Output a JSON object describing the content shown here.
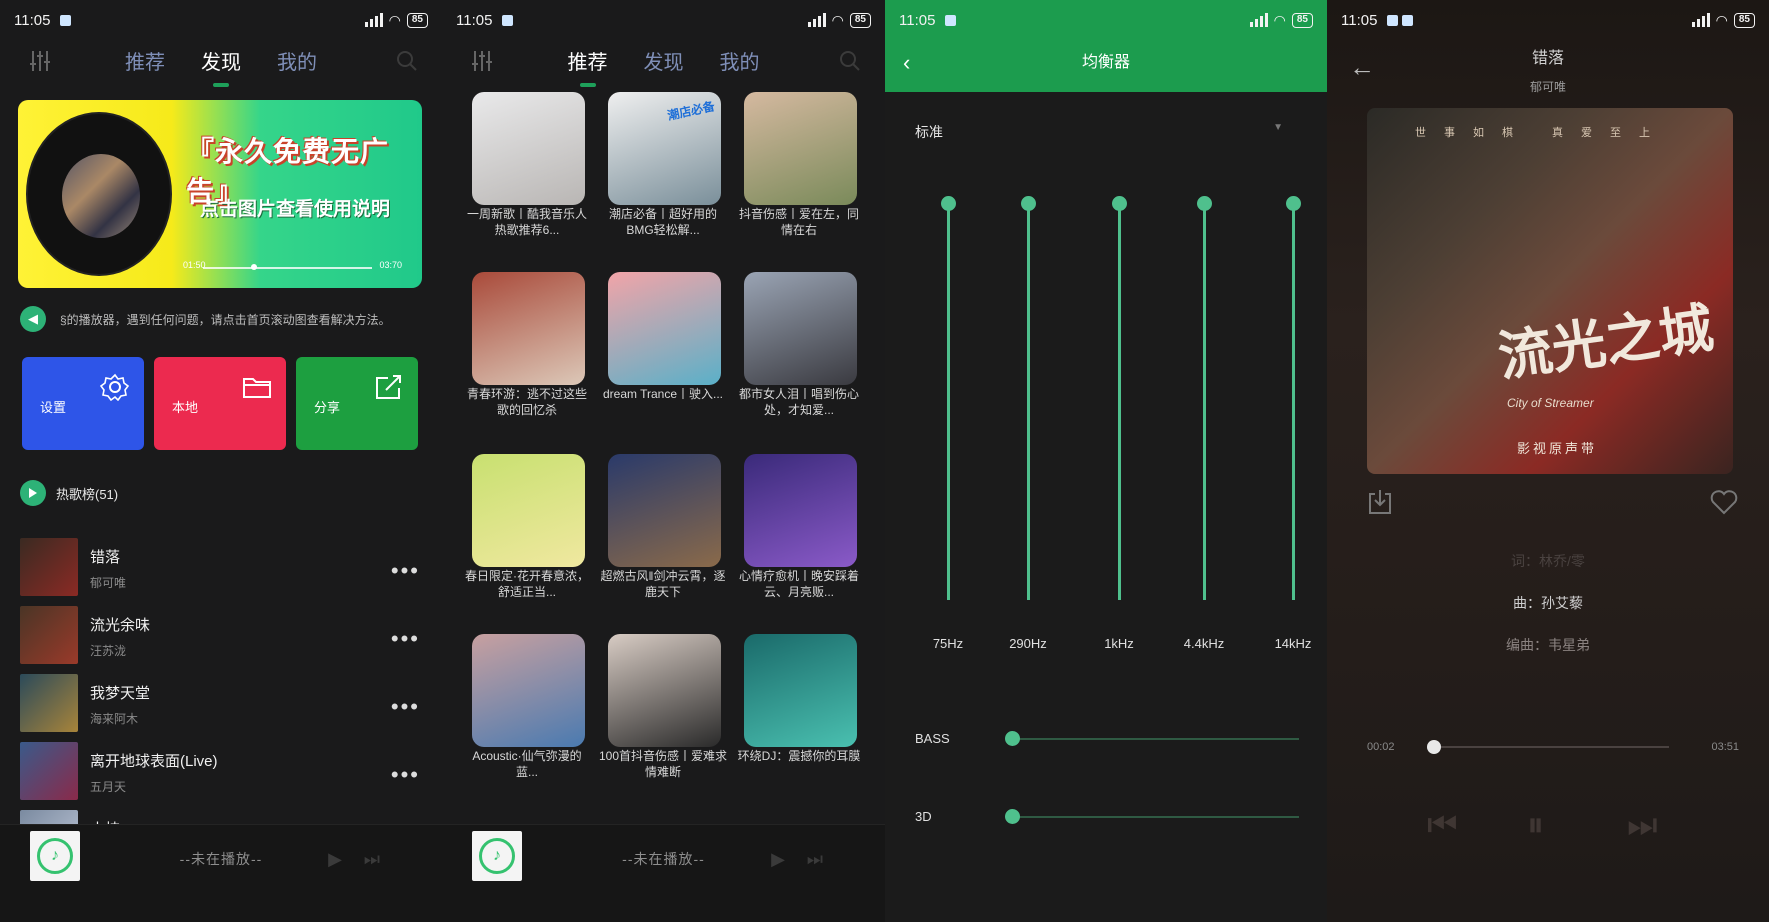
{
  "status": {
    "time": "11:05",
    "battery": "85"
  },
  "nav": {
    "tabs": [
      "推荐",
      "发现",
      "我的"
    ]
  },
  "discover": {
    "banner": {
      "title": "『永久免费无广告』",
      "subtitle": "点击图片查看使用说明",
      "time_start": "01:50",
      "time_end": "03:70"
    },
    "notice": "§的播放器，遇到任何问题，请点击首页滚动图查看解决方法。",
    "quick": {
      "settings": "设置",
      "local": "本地",
      "share": "分享"
    },
    "hot_label": "热歌榜(51)",
    "songs": [
      {
        "name": "错落",
        "artist": "郁可唯",
        "c1": "#3a2a22",
        "c2": "#8b2a24"
      },
      {
        "name": "流光余味",
        "artist": "汪苏泷",
        "c1": "#4a3526",
        "c2": "#9a3a2a"
      },
      {
        "name": "我梦天堂",
        "artist": "海来阿木",
        "c1": "#2b4a5a",
        "c2": "#a8843a"
      },
      {
        "name": "离开地球表面(Live)",
        "artist": "五月天",
        "c1": "#3a5a8a",
        "c2": "#8a2a4a"
      },
      {
        "name": "山楂",
        "artist": "",
        "c1": "#7a8aa0",
        "c2": "#c0c8d8"
      }
    ]
  },
  "recommend": {
    "cards": [
      {
        "caption": "一周新歌丨酷我音乐人热歌推荐6...",
        "c1": "#e9e9ea",
        "c2": "#b9b6b4"
      },
      {
        "caption": "潮店必备丨超好用的BMG轻松解...",
        "c1": "#efefef",
        "c2": "#7a8f9a",
        "tag": "潮店必备"
      },
      {
        "caption": "抖音伤感丨爱在左，同情在右",
        "c1": "#d5b9a0",
        "c2": "#7a8a5a"
      },
      {
        "caption": "青春环游：逃不过这些歌的回忆杀",
        "c1": "#a94a3a",
        "c2": "#dcc8b8"
      },
      {
        "caption": "dream Trance丨驶入...",
        "c1": "#f2a4a8",
        "c2": "#5ab0c8"
      },
      {
        "caption": "都市女人泪丨唱到伤心处，才知爱...",
        "c1": "#9aa4b4",
        "c2": "#3a3a40"
      },
      {
        "caption": "春日限定·花开春意浓，舒适正当...",
        "c1": "#c8e070",
        "c2": "#f0e8a0"
      },
      {
        "caption": "超燃古风‖剑冲云霄，逐鹿天下",
        "c1": "#2a3a6a",
        "c2": "#8a6a4a"
      },
      {
        "caption": "心情疗愈机丨晚安踩着云、月亮贩...",
        "c1": "#3a2a7a",
        "c2": "#8a5ac8"
      },
      {
        "caption": "Acoustic·仙气弥漫的蓝...",
        "c1": "#c8a0a0",
        "c2": "#4a7ab0"
      },
      {
        "caption": "100首抖音伤感丨爱难求情难断",
        "c1": "#d8ccc4",
        "c2": "#2a2a2a"
      },
      {
        "caption": "环绕DJ：震撼你的耳膜",
        "c1": "#1a6a6a",
        "c2": "#4ac0b0"
      }
    ]
  },
  "miniplayer": {
    "text": "--未在播放--"
  },
  "equalizer": {
    "title": "均衡器",
    "preset": "标准",
    "bands": [
      {
        "freq": "75Hz",
        "level": 1.0
      },
      {
        "freq": "290Hz",
        "level": 1.0
      },
      {
        "freq": "1kHz",
        "level": 1.0
      },
      {
        "freq": "4.4kHz",
        "level": 1.0
      },
      {
        "freq": "14kHz",
        "level": 1.0
      }
    ],
    "bass_label": "BASS",
    "bass_level": 0.0,
    "threed_label": "3D",
    "threed_level": 0.0
  },
  "nowplaying": {
    "title": "错落",
    "artist": "郁可唯",
    "album_top_text": "世事如棋 真爱至上",
    "album_calligraphy": "流光之城",
    "album_english": "City of Streamer",
    "album_sub": "影视原声带",
    "lyrics": [
      {
        "text": "词：林乔/零",
        "dim": true
      },
      {
        "text": "曲：孙艾藜",
        "dim": false
      },
      {
        "text": "编曲：韦星弟",
        "dim": false
      }
    ],
    "time_current": "00:02",
    "time_total": "03:51",
    "progress": 0.01
  }
}
